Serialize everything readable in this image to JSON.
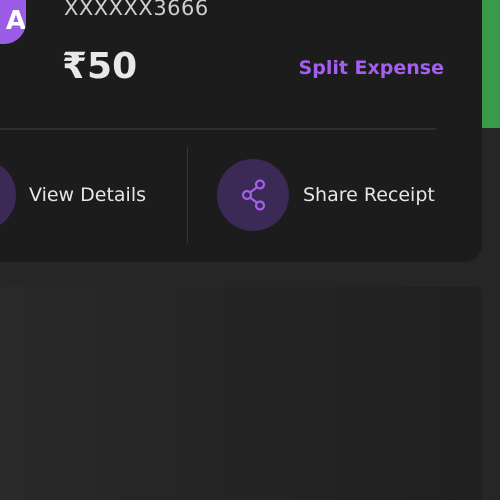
{
  "transaction": {
    "avatar_letter": "A",
    "account_masked": "XXXXXX3666",
    "amount": "₹50",
    "split_label": "Split Expense"
  },
  "actions": {
    "view_details_label": "View Details",
    "share_receipt_label": "Share Receipt"
  },
  "colors": {
    "accent": "#a45ff0",
    "card_bg": "#1c1c1c",
    "page_bg": "#262626",
    "action_circle": "#3a2a55",
    "green_strip": "#3a9a4a"
  },
  "icons": {
    "share": "share-icon",
    "view": "receipt-icon"
  }
}
